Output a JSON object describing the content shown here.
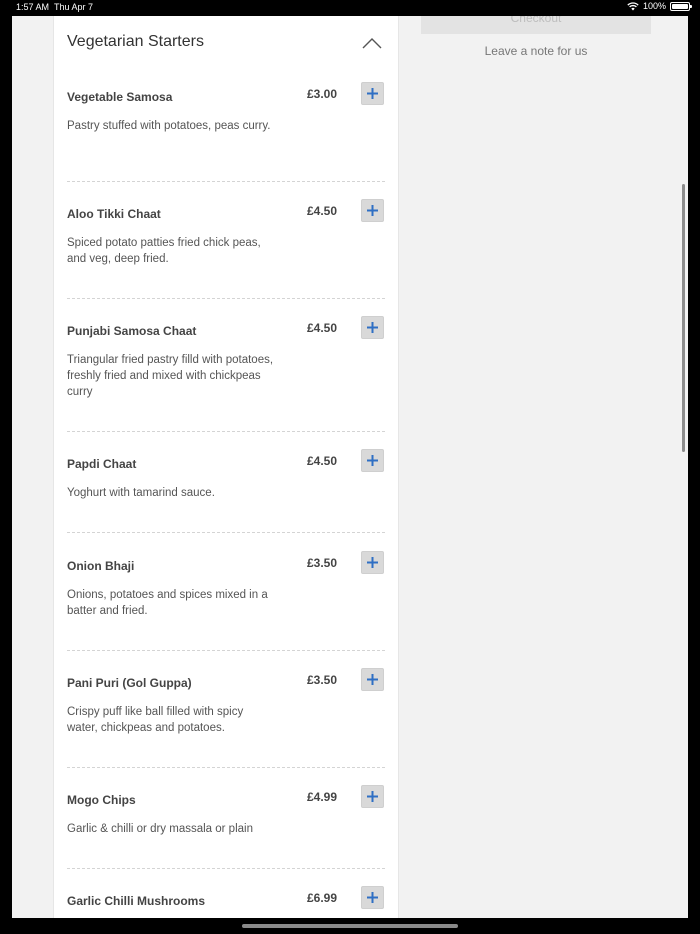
{
  "status_bar": {
    "time": "1:57 AM",
    "date": "Thu Apr 7",
    "battery": "100%"
  },
  "section": {
    "title": "Vegetarian Starters"
  },
  "items": [
    {
      "name": "Vegetable Samosa",
      "price": "£3.00",
      "description": "Pastry stuffed with potatoes, peas curry."
    },
    {
      "name": "Aloo Tikki Chaat",
      "price": "£4.50",
      "description": "Spiced potato patties fried chick peas, and veg, deep fried."
    },
    {
      "name": "Punjabi Samosa Chaat",
      "price": "£4.50",
      "description": "Triangular fried pastry filld with potatoes, freshly fried and mixed with chickpeas curry"
    },
    {
      "name": "Papdi Chaat",
      "price": "£4.50",
      "description": "Yoghurt with tamarind sauce."
    },
    {
      "name": "Onion Bhaji",
      "price": "£3.50",
      "description": "Onions, potatoes and spices mixed in a batter and fried."
    },
    {
      "name": "Pani Puri (Gol Guppa)",
      "price": "£3.50",
      "description": "Crispy puff like ball filled with spicy water, chickpeas and potatoes."
    },
    {
      "name": "Mogo Chips",
      "price": "£4.99",
      "description": "Garlic & chilli or dry massala or plain"
    },
    {
      "name": "Garlic Chilli Mushrooms",
      "price": "£6.99",
      "description": ""
    }
  ],
  "sidebar": {
    "checkout_label": "Checkout",
    "note_label": "Leave a note for us"
  },
  "colors": {
    "accent": "#2f6fc4",
    "button_bg": "#d9d9d9",
    "panel_bg": "#ffffff",
    "page_bg": "#f2f2f2"
  }
}
